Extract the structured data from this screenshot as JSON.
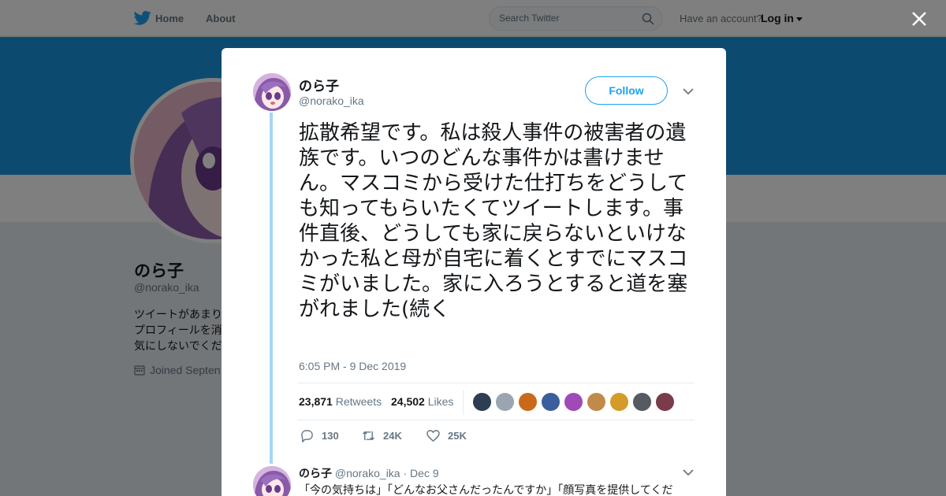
{
  "nav": {
    "home_label": "Home",
    "about_label": "About",
    "search_placeholder": "Search Twitter",
    "account_text": "Have an account?",
    "login_label": "Log in"
  },
  "profile": {
    "name": "のら子",
    "handle": "@norako_ika",
    "bio": "ツイートがあまり\nプロフィールを消\n気にしないでくだ",
    "joined": "Joined Septen"
  },
  "tweet": {
    "author_name": "のら子",
    "author_handle": "@norako_ika",
    "follow_label": "Follow",
    "text": "拡散希望です。私は殺人事件の被害者の遺族です。いつのどんな事件かは書けません。マスコミから受けた仕打ちをどうしても知ってもらいたくてツイートします。事件直後、どうしても家に戻らないといけなかった私と母が自宅に着くとすでにマスコミがいました。家に入ろうとすると道を塞がれました(続く",
    "timestamp": "6:05 PM - 9 Dec 2019",
    "retweets_count": "23,871",
    "retweets_label": "Retweets",
    "likes_count": "24,502",
    "likes_label": "Likes",
    "reply_count": "130",
    "retweet_action_count": "24K",
    "like_action_count": "25K"
  },
  "reply": {
    "author_name": "のら子",
    "author_handle": "@norako_ika",
    "separator": "·",
    "date": "Dec 9",
    "text": "「今の気持ちは」「どんなお父さんだったんですか」「顔写真を提供してくだ"
  },
  "icons": {
    "bird": "twitter-bird-icon",
    "search": "search-icon",
    "close": "close-icon",
    "chevron": "chevron-down-icon",
    "reply": "reply-icon",
    "retweet": "retweet-icon",
    "like": "heart-icon",
    "calendar": "calendar-icon"
  },
  "colors": {
    "brand": "#1da1f2",
    "banner": "#1b95e0",
    "thread_line": "#a3d6f5",
    "muted": "#657786"
  }
}
